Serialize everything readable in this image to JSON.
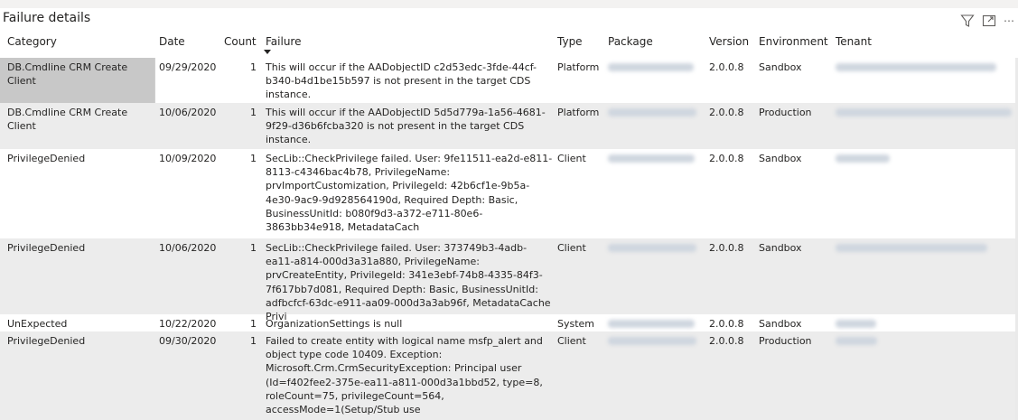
{
  "visual": {
    "title": "Failure details",
    "icons": {
      "filter": "filter-icon",
      "focus": "focus-mode-icon",
      "more": "more-options-icon"
    },
    "more_label": "⋯"
  },
  "columns": {
    "category": "Category",
    "date": "Date",
    "count": "Count",
    "failure": "Failure",
    "type": "Type",
    "package": "Package",
    "version": "Version",
    "environment": "Environment",
    "tenant": "Tenant"
  },
  "rows": [
    {
      "category": "DB.Cmdline CRM Create Client",
      "date": "09/29/2020",
      "count": "1",
      "failure": "This will occur if the AADobjectID c2d53edc-3fde-44cf-b340-b4d1be15b597 is not present in the target CDS instance.",
      "type": "Platform",
      "version": "2.0.0.8",
      "environment": "Sandbox"
    },
    {
      "category": "DB.Cmdline CRM Create Client",
      "date": "10/06/2020",
      "count": "1",
      "failure": "This will occur if the AADobjectID 5d5d779a-1a56-4681-9f29-d36b6fcba320 is not present in the target CDS instance.",
      "type": "Platform",
      "version": "2.0.0.8",
      "environment": "Production"
    },
    {
      "category": "PrivilegeDenied",
      "date": "10/09/2020",
      "count": "1",
      "failure": "SecLib::CheckPrivilege failed. User: 9fe11511-ea2d-e811-8113-c4346bac4b78, PrivilegeName: prvImportCustomization, PrivilegeId: 42b6cf1e-9b5a-4e30-9ac9-9d928564190d, Required Depth: Basic, BusinessUnitId: b080f9d3-a372-e711-80e6-3863bb34e918, MetadataCach",
      "type": "Client",
      "version": "2.0.0.8",
      "environment": "Sandbox"
    },
    {
      "category": "PrivilegeDenied",
      "date": "10/06/2020",
      "count": "1",
      "failure": "SecLib::CheckPrivilege failed. User: 373749b3-4adb-ea11-a814-000d3a31a880, PrivilegeName: prvCreateEntity, PrivilegeId: 341e3ebf-74b8-4335-84f3-7f617bb7d081, Required Depth: Basic, BusinessUnitId: adfbcfcf-63dc-e911-aa09-000d3a3ab96f, MetadataCache Privi",
      "type": "Client",
      "version": "2.0.0.8",
      "environment": "Sandbox"
    },
    {
      "category": "UnExpected",
      "date": "10/22/2020",
      "count": "1",
      "failure": "OrganizationSettings is null",
      "type": "System",
      "version": "2.0.0.8",
      "environment": "Sandbox"
    },
    {
      "category": "PrivilegeDenied",
      "date": "09/30/2020",
      "count": "1",
      "failure": "Failed to create entity with logical name msfp_alert and object type code 10409. Exception: Microsoft.Crm.CrmSecurityException: Principal user (Id=f402fee2-375e-ea11-a811-000d3a1bbd52, type=8, roleCount=75, privilegeCount=564, accessMode=1(Setup/Stub use",
      "type": "Client",
      "version": "2.0.0.8",
      "environment": "Production"
    }
  ]
}
